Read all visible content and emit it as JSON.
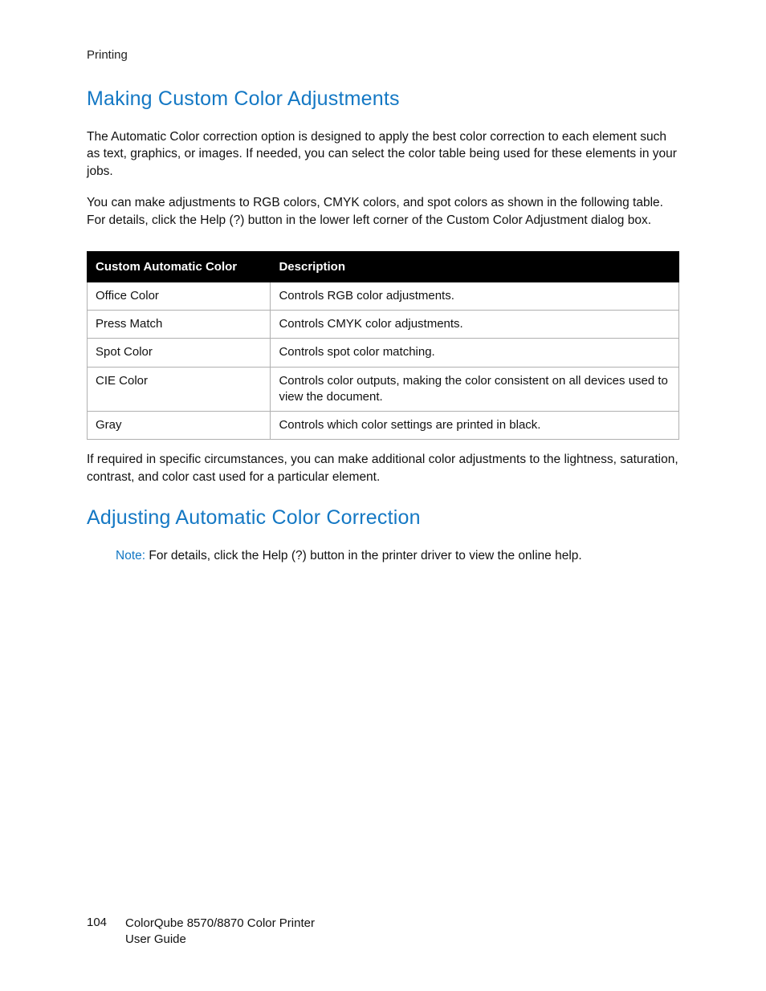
{
  "section_label": "Printing",
  "heading1": "Making Custom Color Adjustments",
  "para1": "The Automatic Color correction option is designed to apply the best color correction to each element such as text, graphics, or images. If needed, you can select the color table being used for these elements in your jobs.",
  "para2": "You can make adjustments to RGB colors, CMYK colors, and spot colors as shown in the following table. For details, click the Help (?) button in the lower left corner of the Custom Color Adjustment dialog box.",
  "table": {
    "headers": {
      "col1": "Custom Automatic Color",
      "col2": "Description"
    },
    "rows": [
      {
        "c1": "Office Color",
        "c2": "Controls RGB color adjustments."
      },
      {
        "c1": "Press Match",
        "c2": "Controls CMYK color adjustments."
      },
      {
        "c1": "Spot Color",
        "c2": "Controls spot color matching."
      },
      {
        "c1": "CIE Color",
        "c2": "Controls color outputs, making the color consistent on all devices used to view the document."
      },
      {
        "c1": "Gray",
        "c2": "Controls which color settings are printed in black."
      }
    ]
  },
  "para3": "If required in specific circumstances, you can make additional color adjustments to the lightness, saturation, contrast, and color cast used for a particular element.",
  "heading2": "Adjusting Automatic Color Correction",
  "note_label": "Note:",
  "note_text": " For details, click the Help (?) button in the printer driver to view the online help.",
  "footer": {
    "page_number": "104",
    "product_line1": "ColorQube 8570/8870 Color Printer",
    "product_line2": "User Guide"
  }
}
